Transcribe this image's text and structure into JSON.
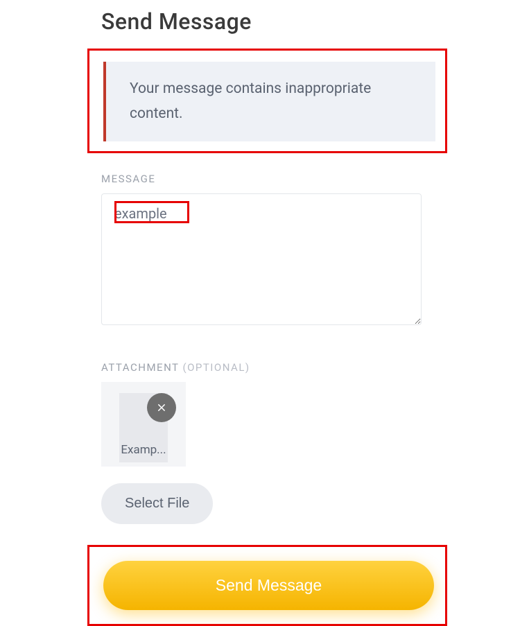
{
  "page": {
    "title": "Send Message"
  },
  "alert": {
    "text": "Your message contains inappropriate content."
  },
  "message": {
    "label": "MESSAGE",
    "value": "example"
  },
  "attachment": {
    "label": "ATTACHMENT ",
    "optional": "(OPTIONAL)",
    "filename": "Examp...",
    "select_label": "Select File"
  },
  "submit": {
    "label": "Send Message"
  }
}
